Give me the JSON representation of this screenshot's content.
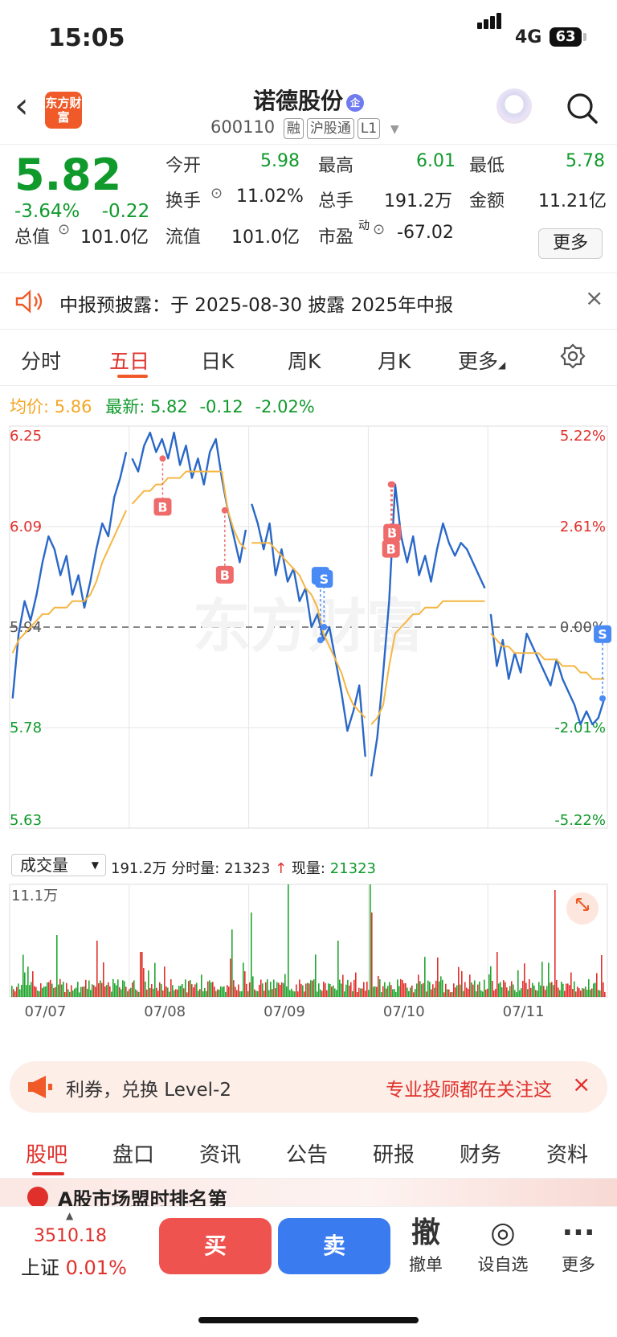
{
  "status": {
    "time": "15:05",
    "network": "4G",
    "battery": "63"
  },
  "header": {
    "logo_text": "东方财富",
    "title": "诺德股份",
    "title_badge": "企",
    "code": "600110",
    "tags": [
      "融",
      "沪股通",
      "L1"
    ]
  },
  "quote": {
    "price": "5.82",
    "change_pct": "-3.64%",
    "change": "-0.22",
    "rows": [
      [
        {
          "label": "今开",
          "value": "5.98",
          "color": "green"
        },
        {
          "label": "最高",
          "value": "6.01",
          "color": "green"
        },
        {
          "label": "最低",
          "value": "5.78",
          "color": "green"
        }
      ],
      [
        {
          "label": "换手",
          "value": "11.02%",
          "color": "black"
        },
        {
          "label": "总手",
          "value": "191.2万",
          "color": "black"
        },
        {
          "label": "金额",
          "value": "11.21亿",
          "color": "black"
        }
      ],
      [
        {
          "label": "总值",
          "value": "101.0亿",
          "color": "black"
        },
        {
          "label": "流值",
          "value": "101.0亿",
          "color": "black"
        },
        {
          "label": "市盈",
          "label_sup": "动",
          "value": "-67.02",
          "color": "black"
        }
      ]
    ],
    "more_label": "更多"
  },
  "notice": {
    "text": "中报预披露：于 2025-08-30 披露 2025年中报"
  },
  "tabs": {
    "items": [
      "分时",
      "五日",
      "日K",
      "周K",
      "月K",
      "更多"
    ],
    "active": "五日"
  },
  "avg_line": {
    "avg_label": "均价:",
    "avg_value": "5.86",
    "latest_label": "最新:",
    "latest_value": "5.82",
    "change": "-0.12",
    "change_pct": "-2.02%"
  },
  "chart_data": {
    "type": "line",
    "title": "",
    "x": [
      "07/07",
      "07/08",
      "07/09",
      "07/10",
      "07/11"
    ],
    "ylim": [
      5.63,
      6.25
    ],
    "y_ticks_left": [
      "6.25",
      "6.09",
      "5.94",
      "5.78",
      "5.63"
    ],
    "y_ticks_right": [
      "5.22%",
      "2.61%",
      "0.00%",
      "-2.01%",
      "-5.22%"
    ],
    "prev_close": 5.94,
    "watermark": "东方财富",
    "series": [
      {
        "values": [
          5.83,
          5.93,
          5.98,
          5.95,
          5.99,
          6.04,
          6.08,
          6.06,
          6.02,
          6.05,
          5.99,
          6.02,
          5.97,
          6.01,
          6.06,
          6.1,
          6.08,
          6.14,
          6.17,
          6.21,
          6.2,
          6.18,
          6.22,
          6.24,
          6.21,
          6.23,
          6.2,
          6.24,
          6.19,
          6.22,
          6.17,
          6.2,
          6.16,
          6.21,
          6.23,
          6.17,
          6.12,
          6.08,
          6.04,
          6.09,
          6.13,
          6.1,
          6.06,
          6.1,
          6.02,
          6.06,
          6.01,
          6.03,
          5.98,
          6.0,
          5.94,
          5.96,
          5.92,
          5.94,
          5.89,
          5.84,
          5.78,
          5.81,
          5.85,
          5.74,
          5.71,
          5.77,
          5.87,
          5.98,
          6.16,
          6.08,
          6.04,
          6.08,
          6.02,
          6.05,
          6.01,
          6.06,
          6.1,
          6.07,
          6.05,
          6.07,
          6.06,
          6.04,
          6.02,
          6.0,
          5.96,
          5.88,
          5.92,
          5.86,
          5.9,
          5.87,
          5.93,
          5.91,
          5.89,
          5.87,
          5.85,
          5.89,
          5.86,
          5.84,
          5.82,
          5.79,
          5.81,
          5.79,
          5.8,
          5.83
        ]
      },
      {
        "values": [
          5.9,
          5.92,
          5.93,
          5.94,
          5.95,
          5.96,
          5.96,
          5.97,
          5.97,
          5.97,
          5.98,
          5.98,
          5.98,
          5.99,
          6.01,
          6.04,
          6.06,
          6.08,
          6.1,
          6.12,
          6.13,
          6.14,
          6.15,
          6.15,
          6.16,
          6.16,
          6.17,
          6.17,
          6.17,
          6.18,
          6.18,
          6.18,
          6.18,
          6.18,
          6.18,
          6.18,
          6.12,
          6.09,
          6.07,
          6.06,
          6.07,
          6.07,
          6.07,
          6.07,
          6.06,
          6.05,
          6.04,
          6.03,
          6.02,
          6.0,
          5.99,
          5.97,
          5.93,
          5.91,
          5.89,
          5.87,
          5.84,
          5.82,
          5.81,
          5.8,
          5.79,
          5.8,
          5.82,
          5.88,
          5.93,
          5.94,
          5.95,
          5.96,
          5.96,
          5.97,
          5.97,
          5.97,
          5.98,
          5.98,
          5.98,
          5.98,
          5.98,
          5.98,
          5.98,
          5.98,
          5.93,
          5.92,
          5.91,
          5.91,
          5.9,
          5.9,
          5.9,
          5.9,
          5.9,
          5.89,
          5.89,
          5.89,
          5.88,
          5.88,
          5.88,
          5.87,
          5.87,
          5.86,
          5.86,
          5.86
        ],
        "color": "#f5b642"
      }
    ],
    "markers": [
      {
        "label": "B",
        "day": 1,
        "pos": 0.28
      },
      {
        "label": "B",
        "day": 1,
        "pos": 0.8
      },
      {
        "label": "S",
        "day": 2,
        "pos": 0.6
      },
      {
        "label": "S",
        "day": 2,
        "pos": 0.63
      },
      {
        "label": "B",
        "day": 3,
        "pos": 0.2
      },
      {
        "label": "B",
        "day": 3,
        "pos": 0.19
      },
      {
        "label": "S",
        "day": 4,
        "pos": 0.96
      }
    ],
    "volume_max_label": "11.1万"
  },
  "volume": {
    "selector": "成交量",
    "total": "191.2万",
    "period_label": "分时量:",
    "period_value": "21323",
    "arrow": "↑",
    "now_label": "现量:",
    "now_value": "21323"
  },
  "banner": {
    "left_text": "利券，兑换 Level-2",
    "right_text": "专业投顾都在关注这"
  },
  "bottom_tabs": {
    "items": [
      "股吧",
      "盘口",
      "资讯",
      "公告",
      "研报",
      "财务",
      "资料"
    ],
    "active": "股吧"
  },
  "peek_text": "A股市场盟时排名第",
  "bottom_bar": {
    "index_value": "3510.18",
    "index_name": "上证",
    "index_change": "0.01%",
    "buy": "买",
    "sell": "卖",
    "actions": [
      {
        "icon": "撤",
        "label": "撤单"
      },
      {
        "icon": "◎",
        "label": "设自选"
      },
      {
        "icon": "···",
        "label": "更多"
      }
    ]
  }
}
